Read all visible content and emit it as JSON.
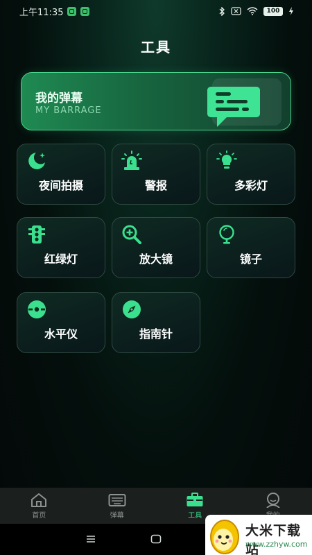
{
  "status_bar": {
    "time": "上午11:35",
    "battery": "100"
  },
  "page": {
    "title": "工具"
  },
  "barrage_card": {
    "title": "我的弹幕",
    "subtitle": "MY BARRAGE",
    "icon": "chat-bubble-icon"
  },
  "tools": [
    {
      "label": "夜间拍摄",
      "icon": "moon-star-icon"
    },
    {
      "label": "警报",
      "icon": "alarm-light-icon"
    },
    {
      "label": "多彩灯",
      "icon": "bulb-icon"
    },
    {
      "label": "红绿灯",
      "icon": "traffic-light-icon"
    },
    {
      "label": "放大镜",
      "icon": "magnifier-plus-icon"
    },
    {
      "label": "镜子",
      "icon": "mirror-icon"
    },
    {
      "label": "水平仪",
      "icon": "level-icon"
    },
    {
      "label": "指南针",
      "icon": "compass-icon"
    }
  ],
  "tab_bar": {
    "tabs": [
      {
        "label": "首页",
        "icon": "home-icon"
      },
      {
        "label": "弹幕",
        "icon": "keyboard-icon"
      },
      {
        "label": "工具",
        "icon": "toolbox-icon"
      },
      {
        "label": "我的",
        "icon": "user-icon"
      }
    ],
    "active_index": 2
  },
  "watermark": {
    "title": "大米下载站",
    "url": "www.zzhyw.com"
  },
  "colors": {
    "accent": "#3be08f",
    "card_border": "#2e4a40"
  }
}
